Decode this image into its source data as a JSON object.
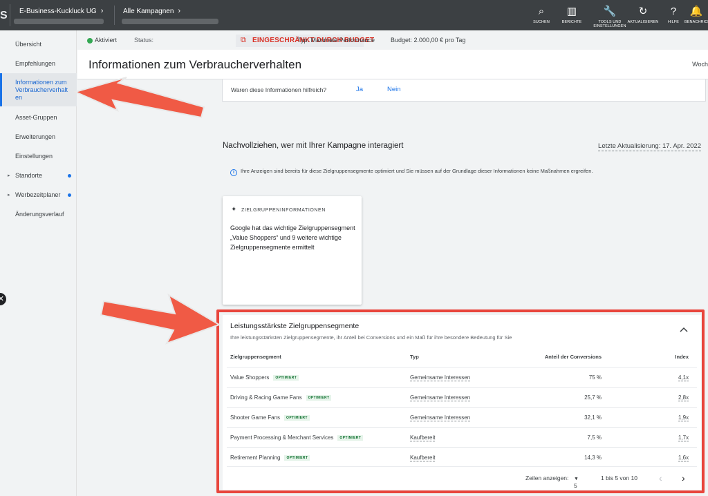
{
  "topbar": {
    "brand_letter": "S",
    "account": "E-Business-Kuckluck UG",
    "campaigns": "Alle Kampagnen",
    "tools": [
      {
        "icon": "search-icon",
        "glyph": "⌕",
        "label": "SUCHEN"
      },
      {
        "icon": "reports-icon",
        "glyph": "▥",
        "label": "BERICHTE"
      },
      {
        "icon": "wrench-icon",
        "glyph": "🔧",
        "label": "TOOLS UND EINSTELLUNGEN"
      },
      {
        "icon": "refresh-icon",
        "glyph": "↻",
        "label": "AKTUALISIEREN"
      },
      {
        "icon": "help-icon",
        "glyph": "?",
        "label": "HILFE"
      },
      {
        "icon": "bell-icon",
        "glyph": "🔔",
        "label": "BENACHRICHTIGUNGEN"
      }
    ]
  },
  "sidebar": {
    "items": [
      {
        "label": "Übersicht"
      },
      {
        "label": "Empfehlungen"
      },
      {
        "label": "Informationen zum Verbraucherverhalten"
      },
      {
        "label": "Asset-Gruppen"
      },
      {
        "label": "Erweiterungen"
      },
      {
        "label": "Einstellungen"
      },
      {
        "label": "Standorte"
      },
      {
        "label": "Werbezeitplaner"
      },
      {
        "label": "Änderungsverlauf"
      }
    ],
    "active_label_lines": [
      "Informationen zum",
      "Verbraucherverhalt",
      "en"
    ]
  },
  "status": {
    "active": "Aktiviert",
    "status_label": "Status:",
    "status_value": "EINGESCHRÄNKT DURCH BUDGET",
    "type": "Typ: Maximale Performance",
    "budget": "Budget: 2.000,00 € pro Tag"
  },
  "header": {
    "title": "Informationen zum Verbraucherverhalten",
    "right_text": "Woch"
  },
  "feedback": {
    "question": "Waren diese Informationen hilfreich?",
    "yes": "Ja",
    "no": "Nein"
  },
  "section": {
    "title": "Nachvollziehen, wer mit Ihrer Kampagne interagiert",
    "last_update": "Letzte Aktualisierung: 17. Apr. 2022",
    "info": "Ihre Anzeigen sind bereits für diese Zielgruppensegmente optimiert und Sie müssen auf der Grundlage dieser Informationen keine Maßnahmen ergreifen."
  },
  "insight_card": {
    "heading": "ZIELGRUPPENINFORMATIONEN",
    "body": "Google hat das wichtige Zielgruppensegment „Value Shoppers“ und 9 weitere wichtige Zielgruppensegmente ermittelt"
  },
  "segments": {
    "title": "Leistungsstärkste Zielgruppensegmente",
    "subtitle": "Ihre leistungsstärksten Zielgruppensegmente, ihr Anteil bei Conversions und ein Maß für ihre besondere Bedeutung für Sie",
    "columns": [
      "Zielgruppensegment",
      "Typ",
      "Anteil der Conversions",
      "Index"
    ],
    "rows": [
      {
        "segment": "Value Shoppers",
        "badge": "OPTIMIERT",
        "type": "Gemeinsame Interessen",
        "share": "75 %",
        "index": "4,1x"
      },
      {
        "segment": "Driving & Racing Game Fans",
        "badge": "OPTIMIERT",
        "type": "Gemeinsame Interessen",
        "share": "25,7 %",
        "index": "2,8x"
      },
      {
        "segment": "Shooter Game Fans",
        "badge": "OPTIMIERT",
        "type": "Gemeinsame Interessen",
        "share": "32,1 %",
        "index": "1,9x"
      },
      {
        "segment": "Payment Processing & Merchant Services",
        "badge": "OPTIMIERT",
        "type": "Kaufbereit",
        "share": "7,5 %",
        "index": "1,7x"
      },
      {
        "segment": "Retirement Planning",
        "badge": "OPTIMIERT",
        "type": "Kaufbereit",
        "share": "14,3 %",
        "index": "1,6x"
      }
    ],
    "pager": {
      "rows_label": "Zeilen anzeigen:",
      "rows_value": "5",
      "range": "1 bis 5 von 10"
    }
  },
  "colors": {
    "accent": "#1a73e8",
    "warning": "#d93025",
    "annotation_red": "#e8453c",
    "topbar": "#3c4043"
  }
}
